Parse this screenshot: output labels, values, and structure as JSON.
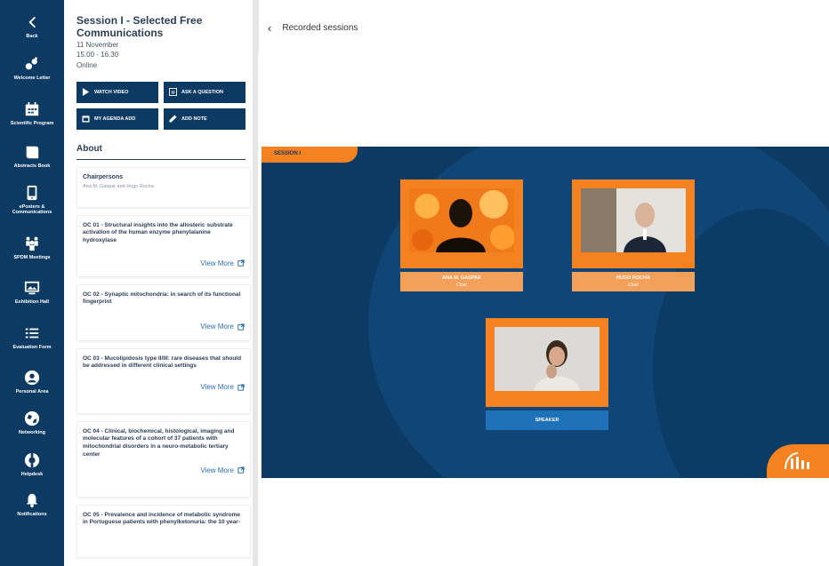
{
  "nav": {
    "items": [
      {
        "label": "Back",
        "icon": "chevron-left-icon"
      },
      {
        "label": "Welcome Letter",
        "icon": "handshake-icon"
      },
      {
        "label": "Scientific Program",
        "icon": "calendar-icon"
      },
      {
        "label": "Abstracts Book",
        "icon": "book-icon"
      },
      {
        "label": "ePosters & Communications",
        "icon": "tablet-icon"
      },
      {
        "label": "SPDM Meetings",
        "icon": "users-icon"
      },
      {
        "label": "Exhibition Hall",
        "icon": "monitor-icon"
      },
      {
        "label": "Evaluation Form",
        "icon": "list-icon"
      },
      {
        "label": "Personal Area",
        "icon": "person-icon"
      },
      {
        "label": "Networking",
        "icon": "globe-icon"
      },
      {
        "label": "Helpdesk",
        "icon": "lifebuoy-icon"
      },
      {
        "label": "Notifications",
        "icon": "bell-icon"
      }
    ]
  },
  "session": {
    "title": "Session I - Selected Free Communications",
    "date": "11 November",
    "time": "15.00 - 16.30",
    "location": "Online",
    "actions": {
      "watch": "WATCH VIDEO",
      "ask": "ASK A QUESTION",
      "agenda": "MY AGENDA ADD",
      "note": "ADD NOTE"
    },
    "about_heading": "About",
    "chair_title": "Chairpersons",
    "chair_names": "Ana M. Gaspar and Hugo Rocha",
    "view_more": "View More",
    "communications": [
      "OC 01 - Structural insights into the allosteric substrate activation of the human enzyme phenylalanine hydroxylase",
      "OC 02 - Synaptic mitochondria: in search of its functional fingerprint",
      "OC 03 - Mucolipidosis type II/III: rare diseases that should be addressed in different clinical settings",
      "OC 04 - Clinical, biochemical, histological, imaging and molecular features of a cohort of 37 patients with mitochondrial disorders in a neuro-metabolic tertiary center",
      "OC 05 - Prevalence and incidence of metabolic syndrome in Portuguese patients with phenylketonuria: the 10 year-"
    ]
  },
  "main": {
    "title": "Recorded sessions",
    "stage_tab": "SESSION I",
    "speakers": [
      {
        "name": "ANA M. GASPAR",
        "role": "Chair"
      },
      {
        "name": "HUGO ROCHA",
        "role": "Chair"
      },
      {
        "name": "SPEAKER",
        "role": ""
      }
    ]
  },
  "colors": {
    "navy": "#0d3a63",
    "orange": "#f58220",
    "link": "#2e6fb1"
  }
}
